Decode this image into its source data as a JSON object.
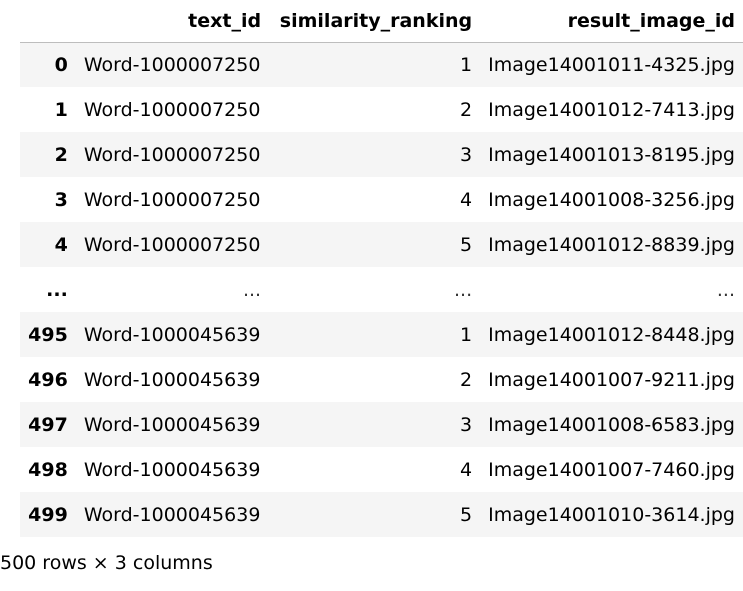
{
  "table": {
    "index_header": "",
    "columns": [
      "text_id",
      "similarity_ranking",
      "result_image_id"
    ],
    "rows": [
      {
        "index": "0",
        "text_id": "Word-1000007250",
        "similarity_ranking": "1",
        "result_image_id": "Image14001011-4325.jpg"
      },
      {
        "index": "1",
        "text_id": "Word-1000007250",
        "similarity_ranking": "2",
        "result_image_id": "Image14001012-7413.jpg"
      },
      {
        "index": "2",
        "text_id": "Word-1000007250",
        "similarity_ranking": "3",
        "result_image_id": "Image14001013-8195.jpg"
      },
      {
        "index": "3",
        "text_id": "Word-1000007250",
        "similarity_ranking": "4",
        "result_image_id": "Image14001008-3256.jpg"
      },
      {
        "index": "4",
        "text_id": "Word-1000007250",
        "similarity_ranking": "5",
        "result_image_id": "Image14001012-8839.jpg"
      },
      {
        "index": "...",
        "text_id": "...",
        "similarity_ranking": "...",
        "result_image_id": "..."
      },
      {
        "index": "495",
        "text_id": "Word-1000045639",
        "similarity_ranking": "1",
        "result_image_id": "Image14001012-8448.jpg"
      },
      {
        "index": "496",
        "text_id": "Word-1000045639",
        "similarity_ranking": "2",
        "result_image_id": "Image14001007-9211.jpg"
      },
      {
        "index": "497",
        "text_id": "Word-1000045639",
        "similarity_ranking": "3",
        "result_image_id": "Image14001008-6583.jpg"
      },
      {
        "index": "498",
        "text_id": "Word-1000045639",
        "similarity_ranking": "4",
        "result_image_id": "Image14001007-7460.jpg"
      },
      {
        "index": "499",
        "text_id": "Word-1000045639",
        "similarity_ranking": "5",
        "result_image_id": "Image14001010-3614.jpg"
      }
    ]
  },
  "shape_caption": "500 rows × 3 columns"
}
